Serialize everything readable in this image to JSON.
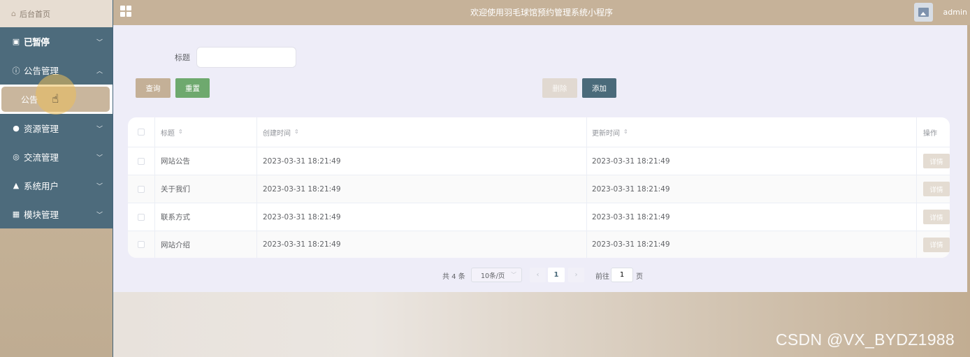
{
  "sidebar": {
    "home_label": "后台首页",
    "home_icon": "home-icon",
    "items": [
      {
        "label": "已暂停",
        "icon": "image-icon",
        "expanded": false
      },
      {
        "label": "公告管理",
        "icon": "info-circle-icon",
        "expanded": true
      },
      {
        "label": "资源管理",
        "icon": "bulb-icon",
        "expanded": false
      },
      {
        "label": "交流管理",
        "icon": "chat-icon",
        "expanded": false
      },
      {
        "label": "系统用户",
        "icon": "user-icon",
        "expanded": false
      },
      {
        "label": "模块管理",
        "icon": "grid-icon",
        "expanded": false
      }
    ],
    "active_sub_item": "公告"
  },
  "header": {
    "title": "欢迎使用羽毛球馆预约管理系统小程序",
    "username": "admin"
  },
  "search": {
    "label": "标题",
    "value": "",
    "placeholder": ""
  },
  "buttons": {
    "query": "查询",
    "reset": "重置",
    "delete": "删除",
    "add": "添加"
  },
  "table": {
    "columns": [
      "标题",
      "创建时间",
      "更新时间",
      "操作"
    ],
    "rows": [
      {
        "title": "网站公告",
        "created": "2023-03-31 18:21:49",
        "updated": "2023-03-31 18:21:49",
        "action": "详情"
      },
      {
        "title": "关于我们",
        "created": "2023-03-31 18:21:49",
        "updated": "2023-03-31 18:21:49",
        "action": "详情"
      },
      {
        "title": "联系方式",
        "created": "2023-03-31 18:21:49",
        "updated": "2023-03-31 18:21:49",
        "action": "详情"
      },
      {
        "title": "网站介绍",
        "created": "2023-03-31 18:21:49",
        "updated": "2023-03-31 18:21:49",
        "action": "详情"
      }
    ]
  },
  "pagination": {
    "total": "共 4 条",
    "page_size": "10条/页",
    "current_page": "1",
    "goto_label": "前往",
    "goto_value": "1",
    "page_suffix": "页"
  },
  "watermark": "CSDN @VX_BYDZ1988",
  "colors": {
    "sidebar_menu_bg": "#4d6b7c",
    "accent_tan": "#c6b299",
    "reset_green": "#6ea96e",
    "add_slate": "#4a6a7a"
  }
}
